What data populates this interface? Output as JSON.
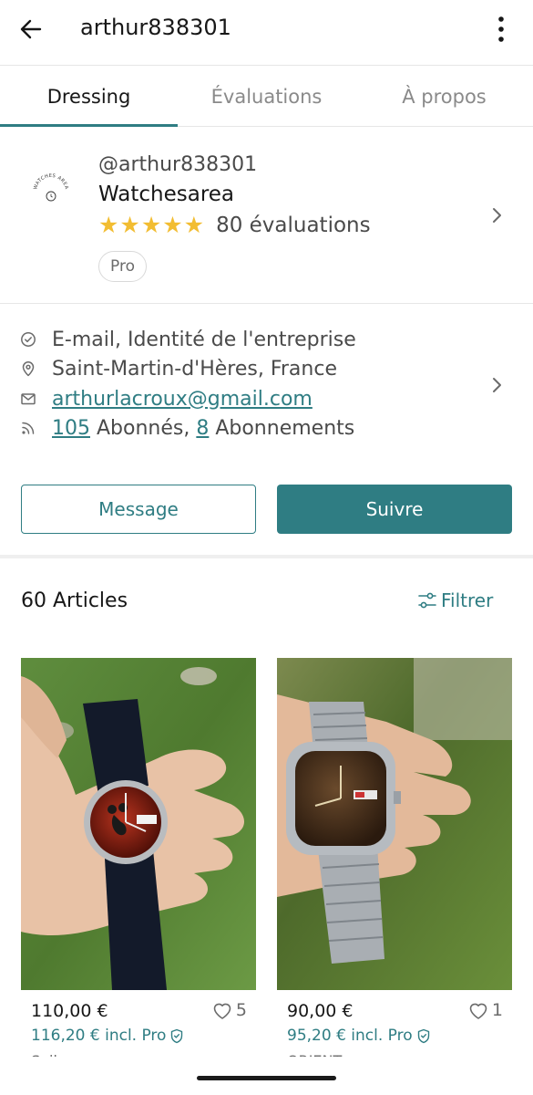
{
  "header": {
    "title": "arthur838301"
  },
  "tabs": [
    {
      "label": "Dressing",
      "active": true
    },
    {
      "label": "Évaluations",
      "active": false
    },
    {
      "label": "À propos",
      "active": false
    }
  ],
  "profile": {
    "handle": "@arthur838301",
    "shop_name": "Watchesarea",
    "stars": "★★★★★",
    "rating_count": "80 évaluations",
    "badge": "Pro",
    "logo_text": "WATCHES AREA"
  },
  "info": {
    "verified": "E-mail, Identité de l'entreprise",
    "location": "Saint-Martin-d'Hères, France",
    "email": "arthurlacroux@gmail.com",
    "followers_count": "105",
    "followers_label": " Abonnés, ",
    "following_count": "8",
    "following_label": " Abonnements"
  },
  "actions": {
    "message": "Message",
    "follow": "Suivre"
  },
  "articles": {
    "count_label": "60 Articles",
    "filter_label": "Filtrer"
  },
  "items": [
    {
      "price": "110,00 €",
      "price_pro": "116,20 € incl. Pro",
      "favorites": "5",
      "brand": "Seiko"
    },
    {
      "price": "90,00 €",
      "price_pro": "95,20 € incl. Pro",
      "favorites": "1",
      "brand": "ORIENT"
    }
  ],
  "colors": {
    "accent": "#2f7d83",
    "star": "#f2bd32",
    "text": "#171717",
    "muted": "#8a8a8a"
  }
}
